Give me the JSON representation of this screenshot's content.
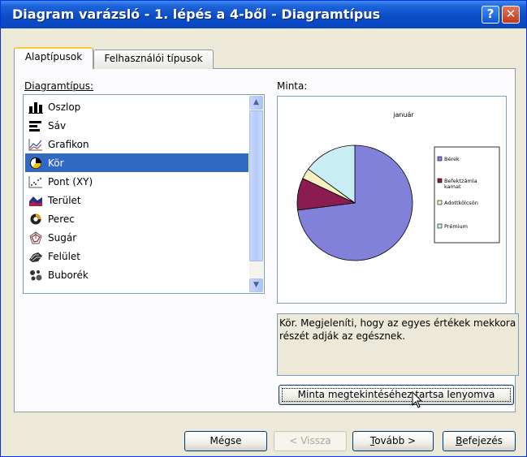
{
  "window": {
    "title": "Diagram varázsló - 1. lépés a 4-ből - Diagramtípus",
    "help_label": "?",
    "close_label": "✕"
  },
  "tabs": [
    {
      "label": "Alaptípusok",
      "active": true
    },
    {
      "label": "Felhasználói típusok",
      "active": false
    }
  ],
  "chart_type_list": {
    "label": "Diagramtípus:",
    "selected": "Kör",
    "items": [
      {
        "label": "Oszlop",
        "icon": "column-chart-icon"
      },
      {
        "label": "Sáv",
        "icon": "bar-chart-icon"
      },
      {
        "label": "Grafikon",
        "icon": "line-chart-icon"
      },
      {
        "label": "Kör",
        "icon": "pie-chart-icon"
      },
      {
        "label": "Pont (XY)",
        "icon": "scatter-chart-icon"
      },
      {
        "label": "Terület",
        "icon": "area-chart-icon"
      },
      {
        "label": "Perec",
        "icon": "doughnut-chart-icon"
      },
      {
        "label": "Sugár",
        "icon": "radar-chart-icon"
      },
      {
        "label": "Felület",
        "icon": "surface-chart-icon"
      },
      {
        "label": "Buborék",
        "icon": "bubble-chart-icon"
      }
    ]
  },
  "sample": {
    "label": "Minta:",
    "description": "Kör. Megjeleníti, hogy az egyes értékek mekkora részét adják az egésznek.",
    "preview_button": "Minta megtekintéséhez tartsa lenyomva"
  },
  "chart_data": {
    "type": "pie",
    "title": "január",
    "categories": [
      "Bérek",
      "Befektzámla kamat",
      "Adottkölcsön",
      "Prémium"
    ],
    "values": [
      73,
      9,
      3,
      15
    ],
    "colors": [
      "#8181d9",
      "#8a1c52",
      "#f5f1c2",
      "#c8eef4"
    ],
    "legend": "right"
  },
  "buttons": {
    "cancel": "Mégse",
    "back": "< Vissza",
    "next_mnemonic": "T",
    "next_rest": "ovább >",
    "finish_mnemonic": "B",
    "finish_rest": "efejezés"
  }
}
